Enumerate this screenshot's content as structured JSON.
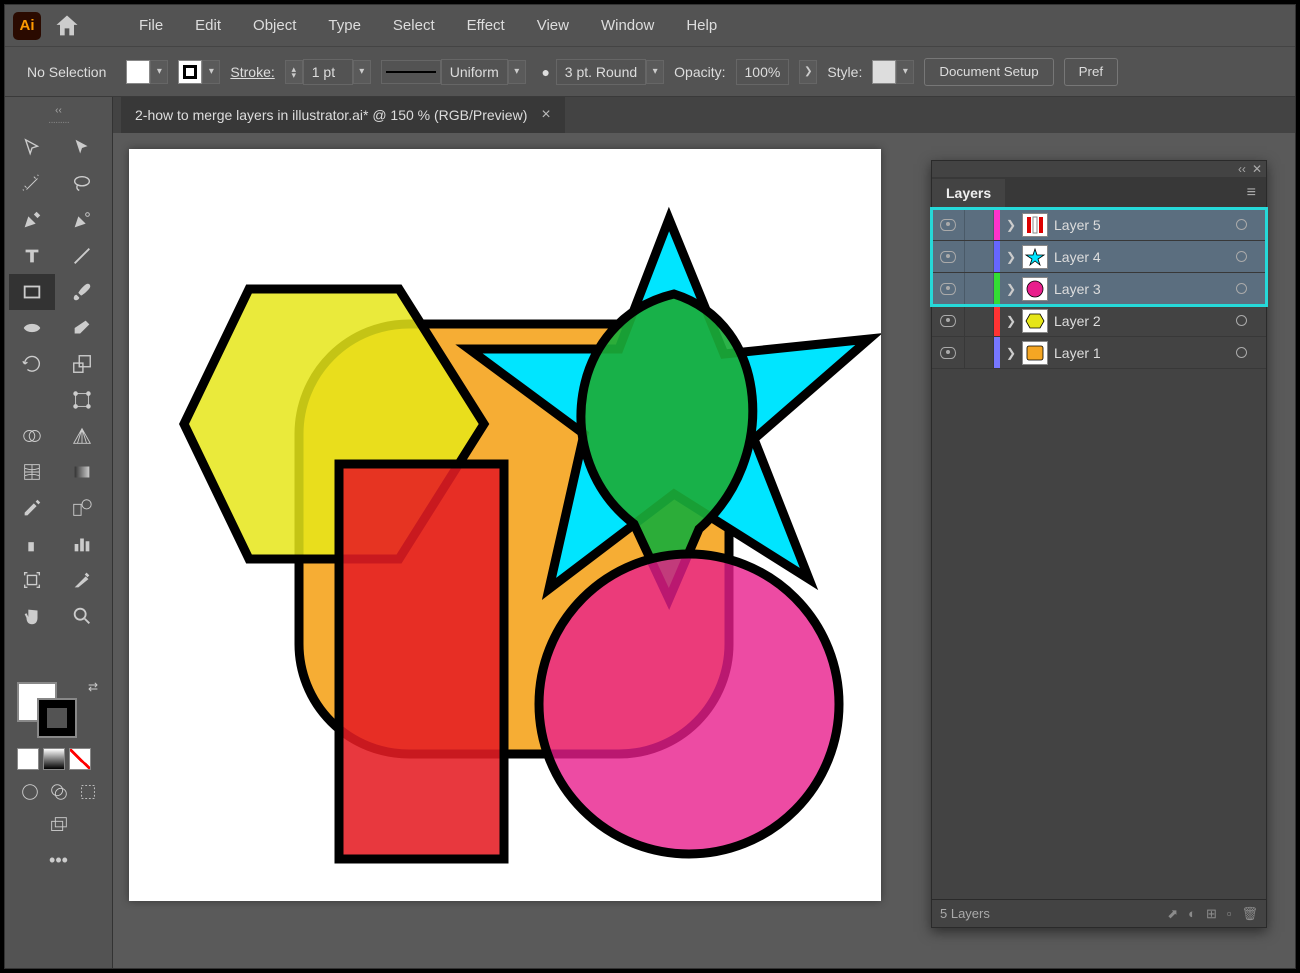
{
  "menu": {
    "items": [
      "File",
      "Edit",
      "Object",
      "Type",
      "Select",
      "Effect",
      "View",
      "Window",
      "Help"
    ]
  },
  "controlbar": {
    "selection": "No Selection",
    "stroke_label": "Stroke:",
    "stroke_weight": "1 pt",
    "profile_label": "Uniform",
    "brush_label": "3 pt. Round",
    "opacity_label": "Opacity:",
    "opacity_value": "100%",
    "style_label": "Style:",
    "doc_setup": "Document Setup",
    "preferences": "Pref"
  },
  "document": {
    "tab_title": "2-how to merge layers in illustrator.ai* @ 150 % (RGB/Preview)"
  },
  "layers_panel": {
    "title": "Layers",
    "footer": "5 Layers",
    "rows": [
      {
        "name": "Layer 5",
        "color": "#ff33cc",
        "selected": true,
        "thumb": "stripes"
      },
      {
        "name": "Layer 4",
        "color": "#6666ff",
        "selected": true,
        "thumb": "star"
      },
      {
        "name": "Layer 3",
        "color": "#33dd33",
        "selected": true,
        "thumb": "circle-pink"
      },
      {
        "name": "Layer 2",
        "color": "#ff3333",
        "selected": false,
        "thumb": "hexagon"
      },
      {
        "name": "Layer 1",
        "color": "#7777ff",
        "selected": false,
        "thumb": "square-orange"
      }
    ]
  },
  "canvas": {
    "shapes": "hexagon-yellow, rounded-square-orange, rectangle-red, circle-pink, star-cyan, teardrop-green"
  }
}
